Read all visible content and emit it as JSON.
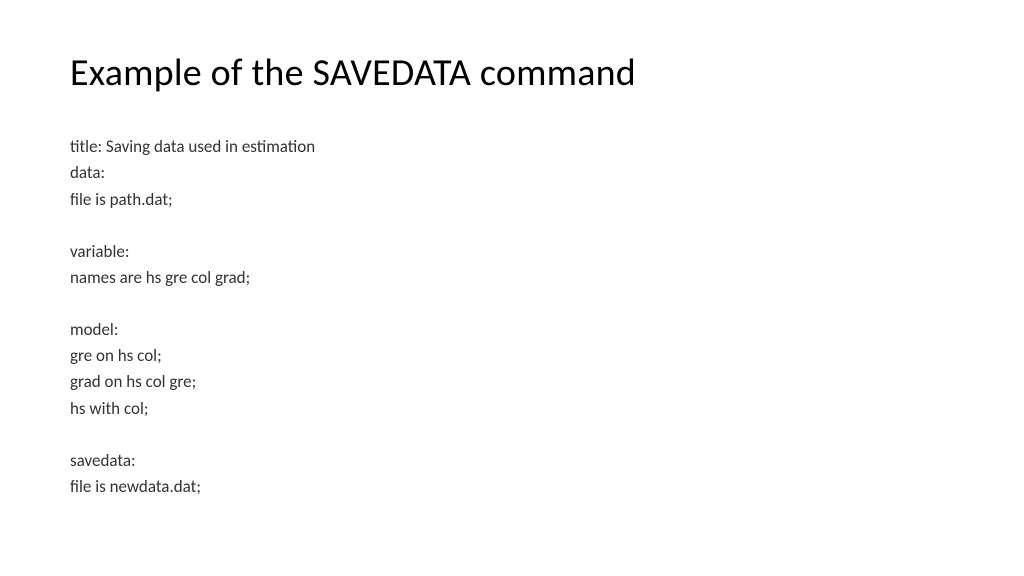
{
  "slide": {
    "title": "Example of the SAVEDATA command",
    "lines": {
      "l1": "title: Saving data used in estimation",
      "l2": "data:",
      "l3": "file is path.dat;",
      "l4": "variable:",
      "l5": "names are hs gre col grad;",
      "l6": "model:",
      "l7": "gre on hs col;",
      "l8": "grad on hs col gre;",
      "l9": "hs with col;",
      "l10": "savedata:",
      "l11": "file is newdata.dat;"
    }
  }
}
